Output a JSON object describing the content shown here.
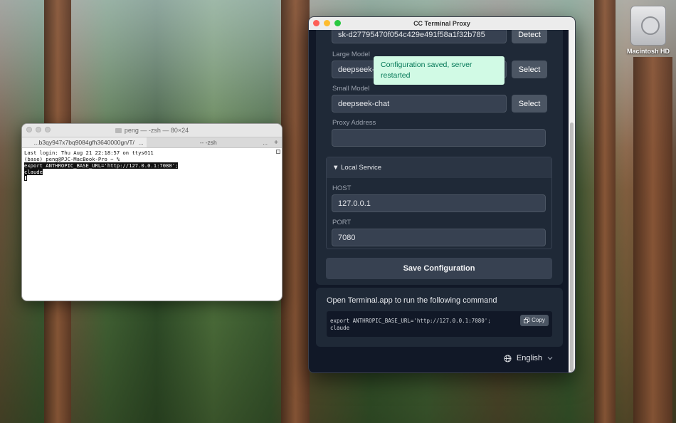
{
  "desktop": {
    "disk_label": "Macintosh HD"
  },
  "terminal": {
    "title": "peng — -zsh — 80×24",
    "tabs": [
      {
        "label": "...b3qy947x7bq9084gfh3640000gn/T/"
      },
      {
        "label": "-- -zsh"
      }
    ],
    "tab_more": "...",
    "new_tab": "+",
    "lines": [
      "Last login: Thu Aug 21 22:18:57 on ttys011",
      "(base) peng@PJC-MacBook-Pro ~ %"
    ],
    "highlighted_lines": [
      "export ANTHROPIC_BASE_URL='http://127.0.0.1:7080';",
      "claude"
    ]
  },
  "app": {
    "title": "CC Terminal Proxy",
    "api_key_partial": "sk-d27795470f054c429e491f58a1f32b785",
    "detect_label": "Detect",
    "toast": "Configuration saved, server restarted",
    "large_model": {
      "label": "Large Model",
      "value": "deepseek-chat",
      "button": "Select"
    },
    "small_model": {
      "label": "Small Model",
      "value": "deepseek-chat",
      "button": "Select"
    },
    "proxy_address": {
      "label": "Proxy Address",
      "value": ""
    },
    "local_service": {
      "header": "▼ Local Service",
      "host_label": "HOST",
      "host_value": "127.0.0.1",
      "port_label": "PORT",
      "port_value": "7080"
    },
    "save_label": "Save Configuration",
    "command_section": {
      "title": "Open Terminal.app to run the following command",
      "line1": "export ANTHROPIC_BASE_URL='http://127.0.0.1:7080';",
      "line2": "claude",
      "copy_label": "Copy"
    },
    "language": {
      "value": "English"
    }
  }
}
